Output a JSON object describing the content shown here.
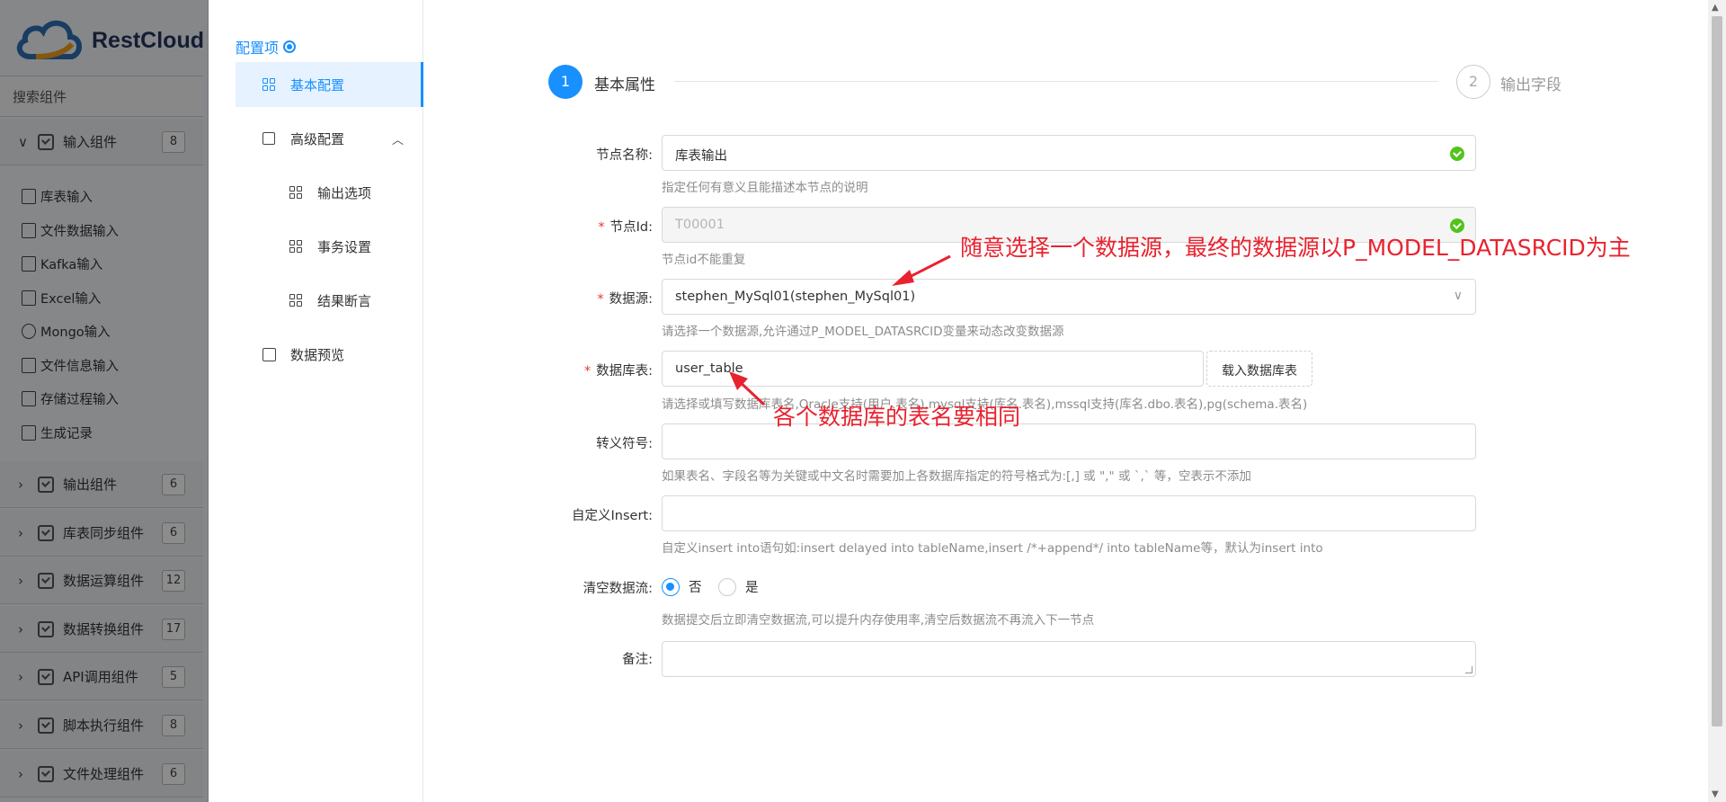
{
  "logo": {
    "text": "RestCloud"
  },
  "left_panel": {
    "search_placeholder": "搜索组件",
    "groups": [
      {
        "label": "输入组件",
        "count": "8",
        "expanded": true
      },
      {
        "label": "输出组件",
        "count": "6"
      },
      {
        "label": "库表同步组件",
        "count": "6"
      },
      {
        "label": "数据运算组件",
        "count": "12"
      },
      {
        "label": "数据转换组件",
        "count": "17"
      },
      {
        "label": "API调用组件",
        "count": "5"
      },
      {
        "label": "脚本执行组件",
        "count": "8"
      },
      {
        "label": "文件处理组件",
        "count": "6"
      }
    ],
    "items": [
      {
        "label": "库表输入"
      },
      {
        "label": "文件数据输入"
      },
      {
        "label": "Kafka输入"
      },
      {
        "label": "Excel输入"
      },
      {
        "label": "Mongo输入"
      },
      {
        "label": "文件信息输入"
      },
      {
        "label": "存储过程输入"
      },
      {
        "label": "生成记录"
      }
    ]
  },
  "config_nav": {
    "title": "配置项",
    "items": [
      {
        "label": "基本配置"
      },
      {
        "label": "高级配置"
      },
      {
        "label": "输出选项"
      },
      {
        "label": "事务设置"
      },
      {
        "label": "结果断言"
      },
      {
        "label": "数据预览"
      }
    ]
  },
  "steps": [
    {
      "num": "1",
      "label": "基本属性"
    },
    {
      "num": "2",
      "label": "输出字段"
    }
  ],
  "form": {
    "node_name": {
      "label": "节点名称:",
      "value": "库表输出",
      "hint": "指定任何有意义且能描述本节点的说明"
    },
    "node_id": {
      "label": "节点Id:",
      "value": "T00001",
      "hint": "节点id不能重复"
    },
    "datasource": {
      "label": "数据源:",
      "value": "stephen_MySql01(stephen_MySql01)",
      "hint": "请选择一个数据源,允许通过P_MODEL_DATASRCID变量来动态改变数据源"
    },
    "db_table": {
      "label": "数据库表:",
      "value": "user_table",
      "button": "载入数据库表",
      "hint": "请选择或填写数据库表名,Oracle支持(用户.表名),mysql支持(库名.表名),mssql支持(库名.dbo.表名),pg(schema.表名)"
    },
    "escape": {
      "label": "转义符号:",
      "value": "",
      "hint": "如果表名、字段名等为关键或中文名时需要加上各数据库指定的符号格式为:[,] 或 \",\" 或 `,` 等，空表示不添加"
    },
    "custom_insert": {
      "label": "自定义Insert:",
      "value": "",
      "hint": "自定义insert into语句如:insert delayed into tableName,insert /*+append*/ into tableName等，默认为insert into"
    },
    "clear_stream": {
      "label": "清空数据流:",
      "options": [
        "否",
        "是"
      ],
      "selected": "否",
      "hint": "数据提交后立即清空数据流,可以提升内存使用率,清空后数据流不再流入下一节点"
    },
    "remark": {
      "label": "备注:",
      "value": ""
    }
  },
  "annotations": {
    "datasource_note": "随意选择一个数据源，最终的数据源以P_MODEL_DATASRCID为主",
    "table_note": "各个数据库的表名要相同",
    "color": "#e8232f"
  },
  "colors": {
    "accent": "#1890ff",
    "success": "#52c41a",
    "required": "#e53935"
  }
}
